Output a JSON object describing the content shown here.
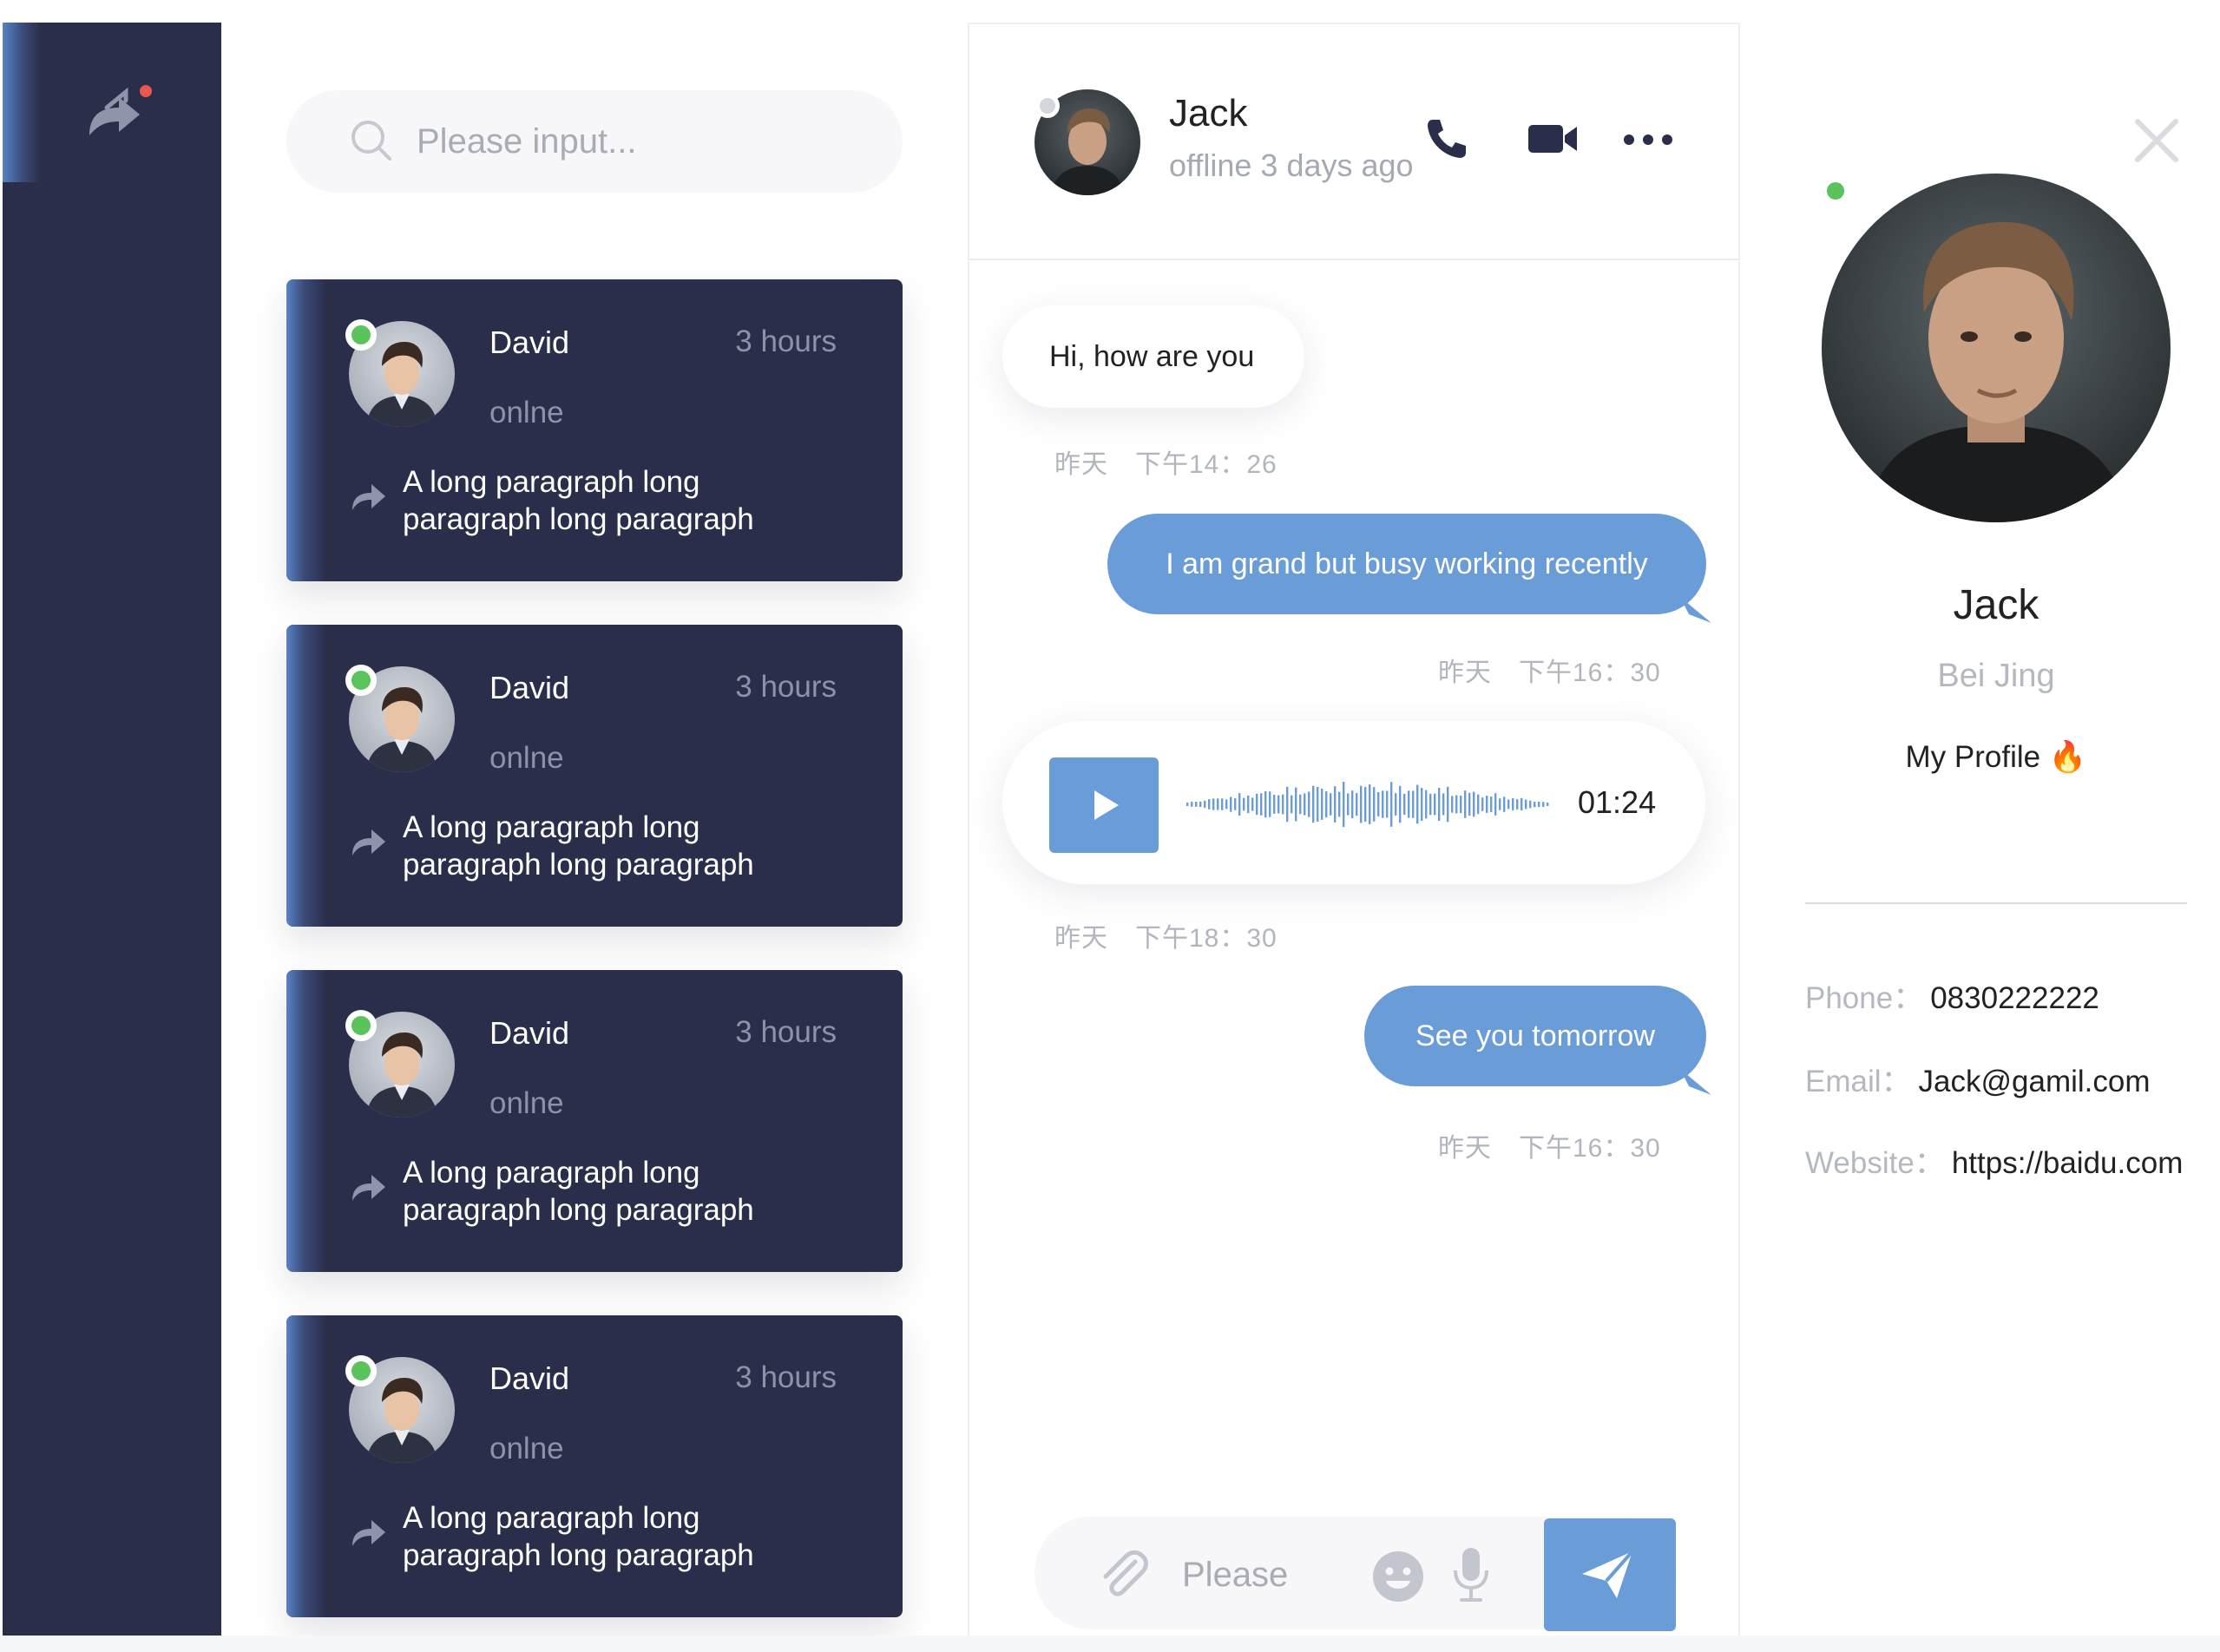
{
  "search": {
    "placeholder": "Please input..."
  },
  "conversations": [
    {
      "name": "David",
      "time": "3 hours",
      "status": "onlne",
      "preview": "A long paragraph long paragraph long paragraph"
    },
    {
      "name": "David",
      "time": "3 hours",
      "status": "onlne",
      "preview": "A long paragraph long paragraph long paragraph"
    },
    {
      "name": "David",
      "time": "3 hours",
      "status": "onlne",
      "preview": "A long paragraph long paragraph long paragraph"
    },
    {
      "name": "David",
      "time": "3 hours",
      "status": "onlne",
      "preview": "A long paragraph long paragraph long paragraph"
    }
  ],
  "chat": {
    "contact_name": "Jack",
    "contact_status": "offline 3 days ago",
    "messages": [
      {
        "direction": "in",
        "text": "Hi, how are you",
        "time": "昨天　下午14：26"
      },
      {
        "direction": "out",
        "text": "I am grand but busy working recently",
        "time": "昨天　下午16：30"
      },
      {
        "direction": "in",
        "type": "voice",
        "duration": "01:24",
        "time": "昨天　下午18：30"
      },
      {
        "direction": "out",
        "text": "See you tomorrow",
        "time": "昨天　下午16：30"
      }
    ],
    "composer_placeholder": "Please"
  },
  "profile": {
    "name": "Jack",
    "city": "Bei Jing",
    "link_label": "My Profile",
    "link_emoji": "🔥",
    "phone_label": "Phone：",
    "phone": "0830222222",
    "email_label": "Email：",
    "email": "Jack@gamil.com",
    "website_label": "Website：",
    "website": "https://baidu.com"
  },
  "colors": {
    "sidebar_bg": "#2a2e4a",
    "accent_blue": "#6a9cd8",
    "online_green": "#5ac35c",
    "notification_red": "#e8584f"
  }
}
